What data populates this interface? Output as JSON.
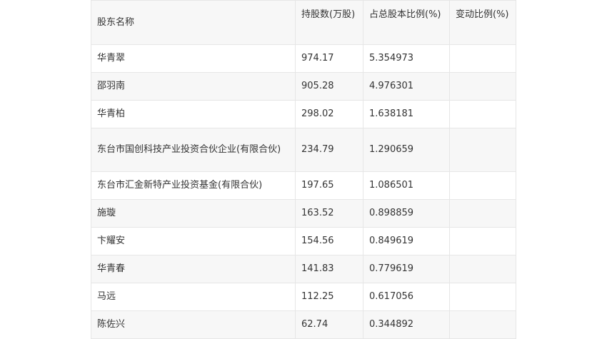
{
  "table": {
    "headers": [
      "股东名称",
      "持股数(万股)",
      "占总股本比例(%)",
      "变动比例(%)"
    ],
    "rows": [
      {
        "name": "华青翠",
        "shares": "974.17",
        "ratio": "5.354973",
        "change": ""
      },
      {
        "name": "邵羽南",
        "shares": "905.28",
        "ratio": "4.976301",
        "change": ""
      },
      {
        "name": "华青柏",
        "shares": "298.02",
        "ratio": "1.638181",
        "change": ""
      },
      {
        "name": "东台市国创科技产业投资合伙企业(有限合伙)",
        "shares": "234.79",
        "ratio": "1.290659",
        "change": ""
      },
      {
        "name": "东台市汇金新特产业投资基金(有限合伙)",
        "shares": "197.65",
        "ratio": "1.086501",
        "change": ""
      },
      {
        "name": "施璇",
        "shares": "163.52",
        "ratio": "0.898859",
        "change": ""
      },
      {
        "name": "卞耀安",
        "shares": "154.56",
        "ratio": "0.849619",
        "change": ""
      },
      {
        "name": "华青春",
        "shares": "141.83",
        "ratio": "0.779619",
        "change": ""
      },
      {
        "name": "马远",
        "shares": "112.25",
        "ratio": "0.617056",
        "change": ""
      },
      {
        "name": "陈佐兴",
        "shares": "62.74",
        "ratio": "0.344892",
        "change": ""
      }
    ]
  }
}
